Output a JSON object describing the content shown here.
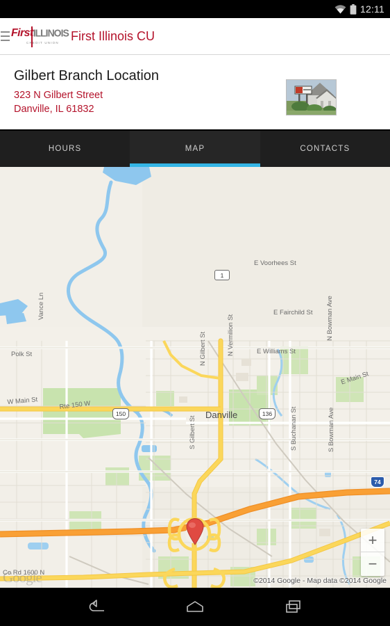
{
  "statusbar": {
    "time": "12:11",
    "wifi_icon": "wifi-icon",
    "battery_icon": "battery-icon"
  },
  "appbar": {
    "menu_icon": "hamburger-menu-icon",
    "logo_first": "First",
    "logo_illinois": "ILLINOIS",
    "logo_subtitle": "CREDIT UNION",
    "app_title": "First Illinois CU"
  },
  "branch": {
    "title": "Gilbert Branch Location",
    "address_line1": "323 N Gilbert Street",
    "address_line2": "Danville, IL  61832",
    "photo_alt": "branch-building-photo"
  },
  "tabs": [
    {
      "label": "HOURS",
      "active": false
    },
    {
      "label": "MAP",
      "active": true
    },
    {
      "label": "CONTACTS",
      "active": false
    }
  ],
  "map": {
    "provider_watermark": "Google",
    "attribution": "©2014 Google - Map data ©2014 Google",
    "marker": "location-pin-marker",
    "zoom_in_label": "+",
    "zoom_out_label": "−",
    "city_label": "Danville",
    "street_labels": [
      "N Gilbert St",
      "N Vermilion St",
      "E Voorhees St",
      "E Fairchild St",
      "E Williams St",
      "N Bowman Ave",
      "E Main St",
      "S Gilbert St",
      "S Buchanan St",
      "S Bowman Ave",
      "W Main St",
      "Rte 150 W",
      "Vance Ln",
      "Polk St",
      "Co Rd 1600 N"
    ],
    "route_shields": [
      {
        "label": "1",
        "type": "state"
      },
      {
        "label": "150",
        "type": "us"
      },
      {
        "label": "136",
        "type": "us"
      },
      {
        "label": "74",
        "type": "interstate"
      }
    ],
    "colors": {
      "land": "#f2efe8",
      "park": "#c8e3ae",
      "water": "#8ec7ee",
      "arterial": "#fbd75b",
      "highway": "#f9a035",
      "accent_tab": "#33b5e5",
      "brand_red": "#b4132b"
    }
  },
  "navbar": {
    "back_icon": "back-arrow-icon",
    "home_icon": "home-icon",
    "recents_icon": "recent-apps-icon"
  }
}
